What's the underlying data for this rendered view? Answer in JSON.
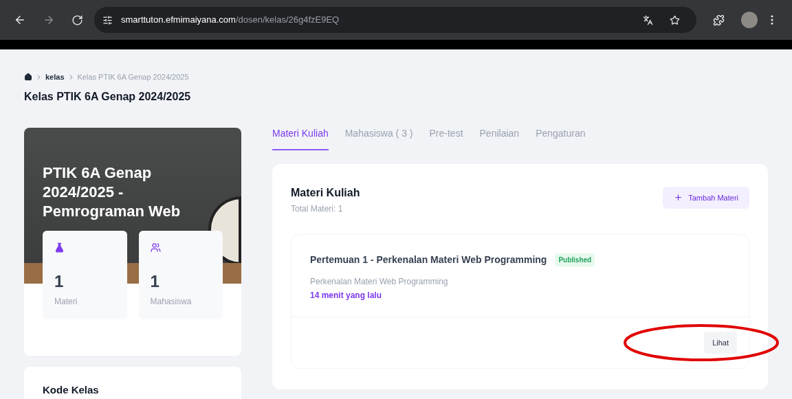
{
  "browser": {
    "url_host": "smarttuton.efmimaiyana.com",
    "url_path": "/dosen/kelas/26g4fzE9EQ"
  },
  "breadcrumb": [
    {
      "label": "kelas",
      "current": false
    },
    {
      "label": "Kelas PTIK 6A Genap 2024/2025",
      "current": true
    }
  ],
  "page_title": "Kelas PTIK 6A Genap 2024/2025",
  "class_card": {
    "title": "PTIK 6A Genap 2024/2025 - Pemrograman Web",
    "stats": [
      {
        "kind": "materi",
        "value": "1",
        "label": "Materi"
      },
      {
        "kind": "mahasiswa",
        "value": "1",
        "label": "Mahasiswa"
      }
    ]
  },
  "code_card": {
    "title": "Kode Kelas"
  },
  "tabs": [
    {
      "label": "Materi Kuliah",
      "selected": true
    },
    {
      "label": "Mahasiswa ( 3 )",
      "selected": false
    },
    {
      "label": "Pre-test",
      "selected": false
    },
    {
      "label": "Penilaian",
      "selected": false
    },
    {
      "label": "Pengaturan",
      "selected": false
    }
  ],
  "panel": {
    "title": "Materi Kuliah",
    "subtitle": "Total Materi: 1",
    "add_button": "Tambah Materi",
    "items": [
      {
        "title": "Pertemuan 1 - Perkenalan Materi Web Programming",
        "status": "Published",
        "description": "Perkenalan Materi Web Programming",
        "time": "14 menit yang lalu",
        "button": "Lihat"
      }
    ]
  }
}
